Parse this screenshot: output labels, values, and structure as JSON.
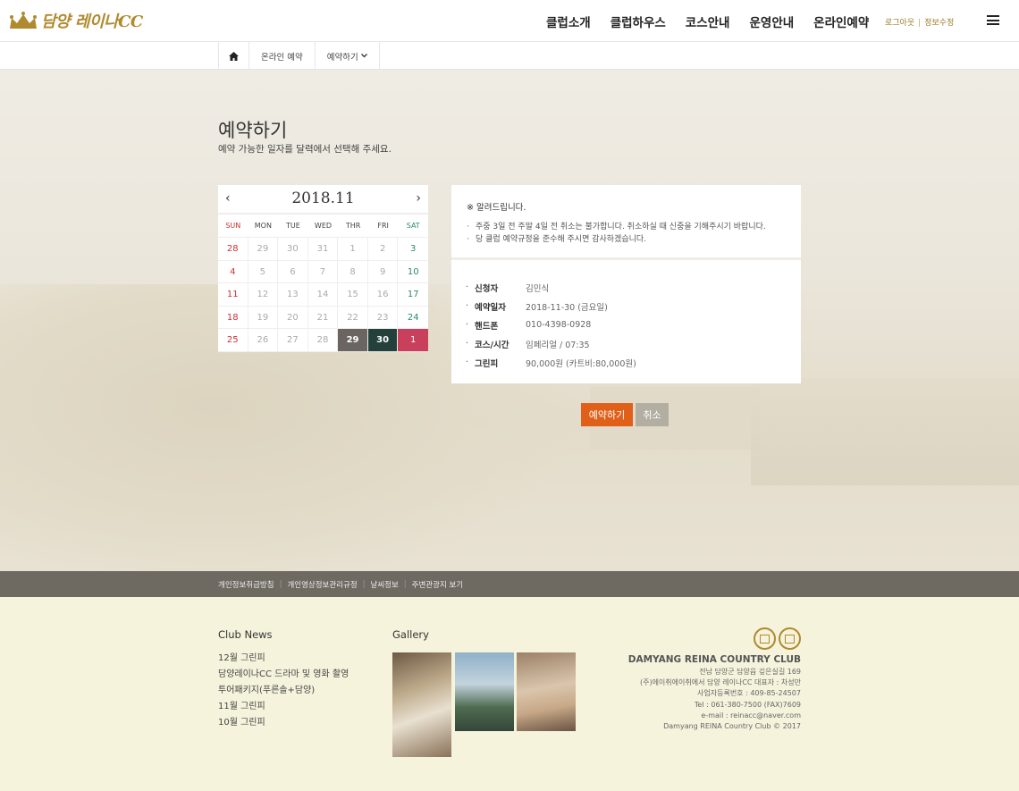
{
  "header": {
    "logo_text": "담양 레이나CC",
    "nav": [
      "클럽소개",
      "클럽하우스",
      "코스안내",
      "운영안내",
      "온라인예약"
    ],
    "util": {
      "logout": "로그아웃",
      "separator": "|",
      "edit_info": "정보수정"
    },
    "icons": {
      "menu": "hamburger-icon",
      "logo": "crown-logo-icon"
    }
  },
  "breadcrumb": {
    "home_icon": "home-icon",
    "level1": "온라인 예약",
    "level2": "예약하기",
    "dropdown_icon": "chevron-down-icon"
  },
  "page": {
    "title": "예약하기",
    "subtitle": "예약 가능한 일자를 달력에서 선택해 주세요."
  },
  "calendar": {
    "month_label": "2018.11",
    "prev": "‹",
    "next": "›",
    "weekdays": [
      "SUN",
      "MON",
      "TUE",
      "WED",
      "THR",
      "FRI",
      "SAT"
    ],
    "days": [
      "28",
      "29",
      "30",
      "31",
      "1",
      "2",
      "3",
      "4",
      "5",
      "6",
      "7",
      "8",
      "9",
      "10",
      "11",
      "12",
      "13",
      "14",
      "15",
      "16",
      "17",
      "18",
      "19",
      "20",
      "21",
      "22",
      "23",
      "24",
      "25",
      "26",
      "27",
      "28",
      "29",
      "30",
      "1"
    ],
    "highlight": {
      "29": "#6a6560",
      "30": "#24403a",
      "1": "#c9405c"
    }
  },
  "notice": {
    "title": "※ 알려드립니다.",
    "lines": [
      "주중 3일 전 주말 4일 전 취소는 불가합니다. 취소하실 때 신중을 기해주시기 바랍니다.",
      "당 클럽 예약규정을 준수해 주시면 감사하겠습니다."
    ]
  },
  "reservation": {
    "rows": [
      {
        "label": "신청자",
        "value": "김민식"
      },
      {
        "label": "예약일자",
        "value": "2018-11-30 (금요일)"
      },
      {
        "label": "핸드폰",
        "value": "010-4398-0928"
      },
      {
        "label": "코스/시간",
        "value": "임페리얼 / 07:35"
      },
      {
        "label": "그린피",
        "value": "90,000원 (카트비:80,000원)"
      }
    ]
  },
  "buttons": {
    "reserve": "예약하기",
    "cancel": "취소"
  },
  "footer_links": [
    "개인정보취급방침",
    "개인영상정보관리규정",
    "날씨정보",
    "주변관광지 보기"
  ],
  "club_news": {
    "title": "Club News",
    "items": [
      "12월 그린피",
      "담양레이나CC 드라마 및 영화 촬영",
      "투어패키지(푸른솔+담양)",
      "11월 그린피",
      "10월 그린피"
    ]
  },
  "gallery": {
    "title": "Gallery"
  },
  "club": {
    "name": "DAMYANG REINA COUNTRY CLUB",
    "lines": [
      "전남 담양군 담양읍 깊은실길 169",
      "(주)에이취에이취에서  담양 레이나CC  대표자 : 차성만",
      "사업자등록번호 : 409-85-24507",
      "Tel : 061-380-7500 (FAX)7609",
      "e-mail : reinacc@naver.com",
      "Damyang REINA Country Club © 2017"
    ],
    "icons": [
      "calendar-icon",
      "map-icon"
    ]
  },
  "colors": {
    "accent": "#e0601a",
    "gold": "#b08a2e",
    "footer_bar": "#6e6961",
    "footer_bg": "#f5f3dc"
  }
}
